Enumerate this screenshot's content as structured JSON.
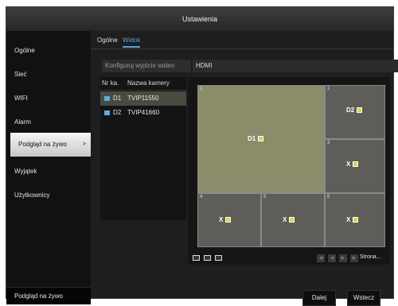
{
  "window": {
    "title": "Ustawienia"
  },
  "sidebar": {
    "items": [
      {
        "label": "Ogólne"
      },
      {
        "label": "Sieć"
      },
      {
        "label": "WIFI"
      },
      {
        "label": "Alarm"
      },
      {
        "label": "Podgląd na żywo",
        "arrow": ">"
      },
      {
        "label": "Wyjątek"
      },
      {
        "label": "Użytkownicy"
      }
    ],
    "bottom_label": "Podgląd na żywo"
  },
  "tabs": [
    {
      "label": "Ogólne"
    },
    {
      "label": "Widok"
    }
  ],
  "output": {
    "label": "Konfiguruj wyjście wideo",
    "value": "HDMI"
  },
  "camera_table": {
    "headers": {
      "nr": "Nr ka.",
      "name": "Nazwa kamery"
    },
    "rows": [
      {
        "nr": "D1",
        "name": "TVIP11550"
      },
      {
        "nr": "D2",
        "name": "TVIP41660"
      }
    ]
  },
  "layout": {
    "cells": [
      {
        "num": "1",
        "label": "D1"
      },
      {
        "num": "2",
        "label": "D2"
      },
      {
        "num": "3",
        "label": "X"
      },
      {
        "num": "4",
        "label": "X"
      },
      {
        "num": "5",
        "label": "X"
      },
      {
        "num": "6",
        "label": "X"
      }
    ],
    "page_label": "Strona..."
  },
  "footer": {
    "next": "Dalej",
    "back": "Wstecz"
  }
}
